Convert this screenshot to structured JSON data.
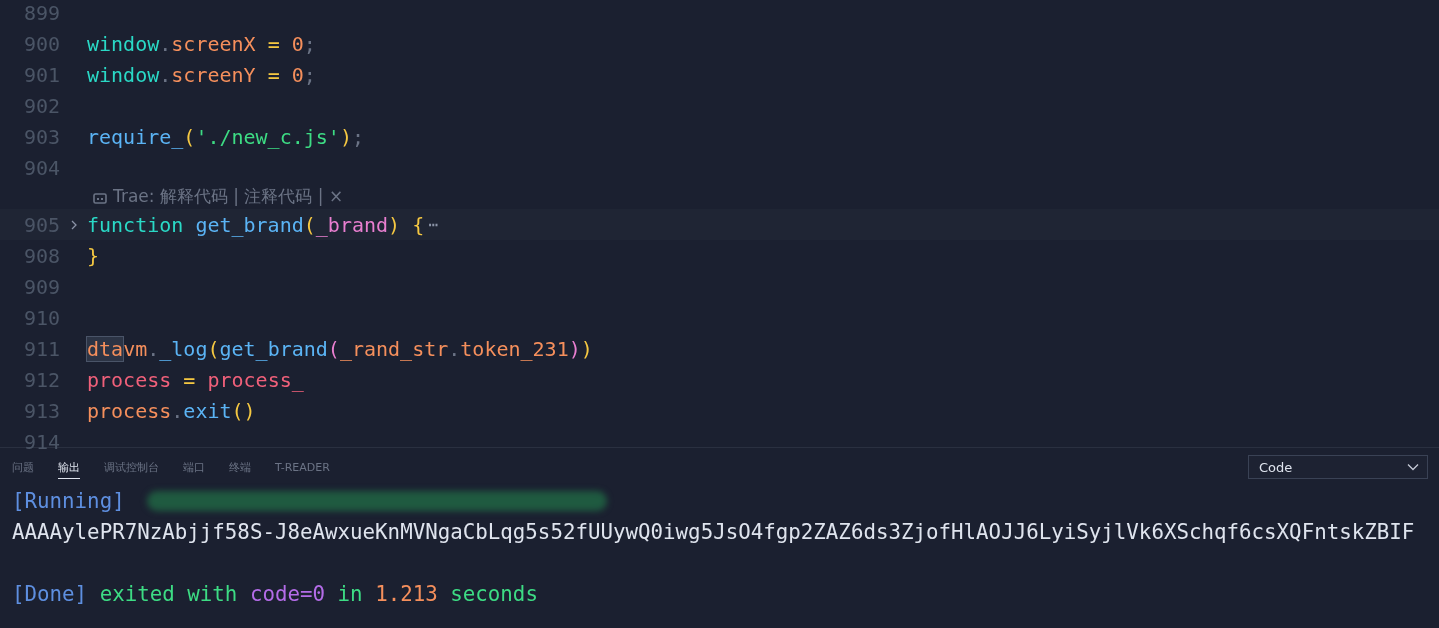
{
  "editor": {
    "lines": [
      {
        "number": "899"
      },
      {
        "number": "900",
        "tokens": [
          {
            "text": "window",
            "kind": "keyword"
          },
          {
            "text": ".",
            "kind": "punctuation"
          },
          {
            "text": "screenX",
            "kind": "property"
          },
          {
            "text": " = ",
            "kind": "operator"
          },
          {
            "text": "0",
            "kind": "property"
          },
          {
            "text": ";",
            "kind": "punctuation"
          }
        ]
      },
      {
        "number": "901",
        "tokens": [
          {
            "text": "window",
            "kind": "keyword"
          },
          {
            "text": ".",
            "kind": "punctuation"
          },
          {
            "text": "screenY",
            "kind": "property"
          },
          {
            "text": " = ",
            "kind": "operator"
          },
          {
            "text": "0",
            "kind": "property"
          },
          {
            "text": ";",
            "kind": "punctuation"
          }
        ]
      },
      {
        "number": "902"
      },
      {
        "number": "903",
        "tokens": [
          {
            "text": "require_",
            "kind": "function"
          },
          {
            "text": "(",
            "kind": "bracket"
          },
          {
            "text": "'./new_c.js'",
            "kind": "string"
          },
          {
            "text": ")",
            "kind": "bracket"
          },
          {
            "text": ";",
            "kind": "punctuation"
          }
        ]
      },
      {
        "number": "904"
      },
      {
        "kind": "codelens",
        "label": "Trae: 解释代码 | 注释代码 | ×"
      },
      {
        "number": "905",
        "folded": true,
        "current": true,
        "tokens": [
          {
            "text": "function ",
            "kind": "keyword"
          },
          {
            "text": "get_brand",
            "kind": "function"
          },
          {
            "text": "(",
            "kind": "bracket"
          },
          {
            "text": "_brand",
            "kind": "parameter"
          },
          {
            "text": ")",
            "kind": "bracket"
          },
          {
            "text": " {",
            "kind": "bracket"
          }
        ],
        "fold_marker": "⋯"
      },
      {
        "number": "908",
        "tokens": [
          {
            "text": "}",
            "kind": "bracket"
          }
        ]
      },
      {
        "number": "909"
      },
      {
        "number": "910"
      },
      {
        "number": "911",
        "tokens": [
          {
            "text": "dta",
            "kind": "property",
            "boxed": true
          },
          {
            "text": "vm",
            "kind": "property"
          },
          {
            "text": ".",
            "kind": "punctuation"
          },
          {
            "text": "_log",
            "kind": "function"
          },
          {
            "text": "(",
            "kind": "bracket"
          },
          {
            "text": "get_brand",
            "kind": "function"
          },
          {
            "text": "(",
            "kind": "bracket2"
          },
          {
            "text": "_rand_str",
            "kind": "property"
          },
          {
            "text": ".",
            "kind": "punctuation"
          },
          {
            "text": "token_231",
            "kind": "property"
          },
          {
            "text": ")",
            "kind": "bracket2"
          },
          {
            "text": ")",
            "kind": "bracket"
          }
        ]
      },
      {
        "number": "912",
        "tokens": [
          {
            "text": "process",
            "kind": "global"
          },
          {
            "text": " = ",
            "kind": "operator"
          },
          {
            "text": "process_",
            "kind": "global"
          }
        ]
      },
      {
        "number": "913",
        "tokens": [
          {
            "text": "process",
            "kind": "property"
          },
          {
            "text": ".",
            "kind": "punctuation"
          },
          {
            "text": "exit",
            "kind": "function"
          },
          {
            "text": "()",
            "kind": "bracket"
          }
        ]
      },
      {
        "number": "914"
      }
    ]
  },
  "panel": {
    "tabs": [
      {
        "label": "问题",
        "selected": false
      },
      {
        "label": "输出",
        "selected": true
      },
      {
        "label": "调试控制台",
        "selected": false
      },
      {
        "label": "端口",
        "selected": false
      },
      {
        "label": "终端",
        "selected": false
      },
      {
        "label": "T-READER",
        "selected": false
      }
    ],
    "channel_select": {
      "value": "Code"
    },
    "output": [
      {
        "segments": [
          {
            "text": "[Running]",
            "kind": "tag"
          }
        ],
        "redacted": true
      },
      {
        "segments": [
          {
            "text": "AAAAylePR7NzAbjjf58S-J8eAwxueKnMVNgaCbLqg5s52fUUywQ0iwg5JsO4fgp2ZAZ6ds3ZjofHlAOJJ6LyiSyjlVk6XSchqf6csXQFntskZBIF",
            "kind": "plain"
          }
        ]
      },
      {
        "segments": [
          {
            "text": "[Done]",
            "kind": "tag"
          },
          {
            "text": " exited with ",
            "kind": "text"
          },
          {
            "text": "code=0",
            "kind": "code"
          },
          {
            "text": " in ",
            "kind": "text"
          },
          {
            "text": "1.213",
            "kind": "number"
          },
          {
            "text": " seconds",
            "kind": "text"
          }
        ]
      }
    ]
  }
}
